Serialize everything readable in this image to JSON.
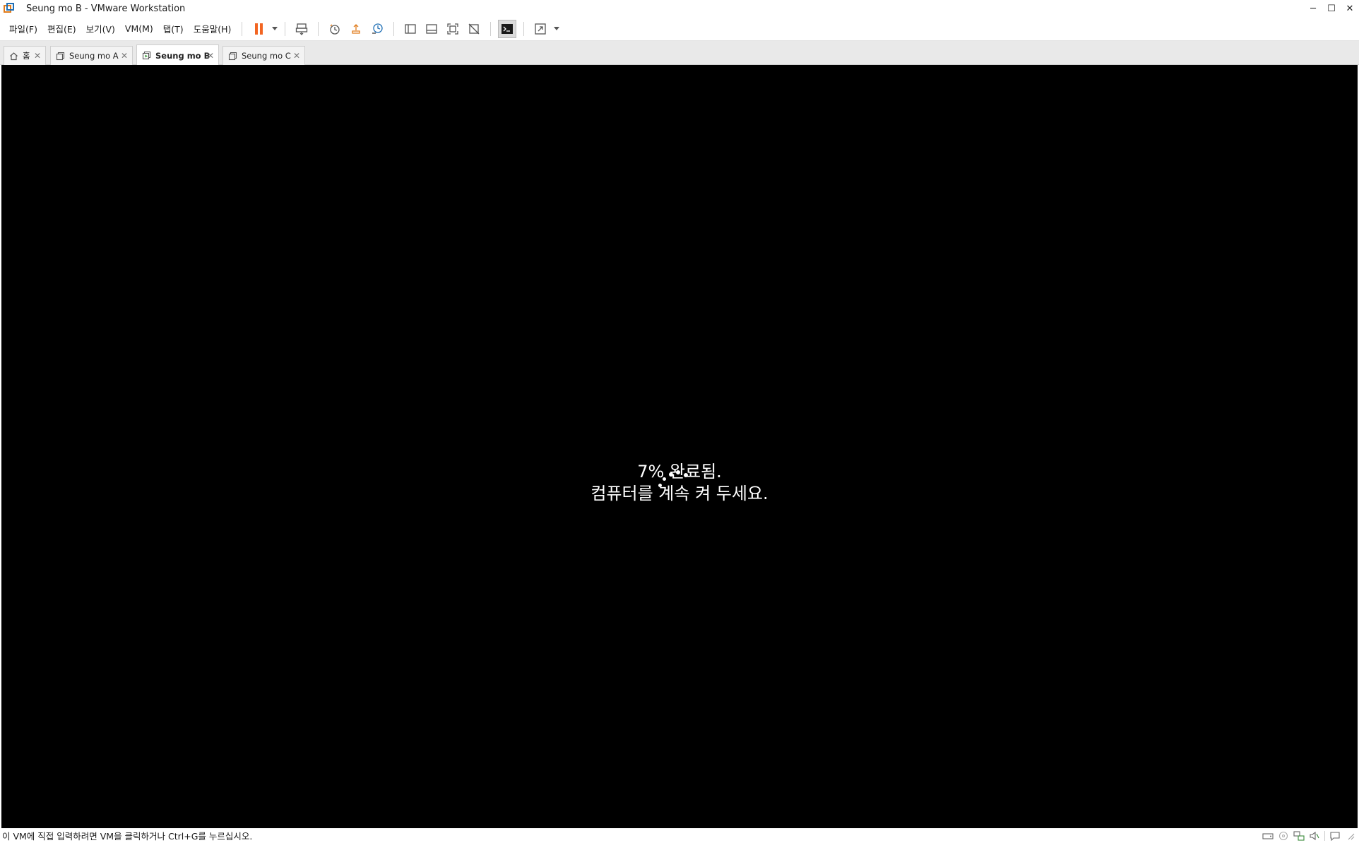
{
  "window": {
    "title": "Seung mo B - VMware Workstation",
    "controls": {
      "minimize": "─",
      "maximize": "☐",
      "close": "✕"
    }
  },
  "menu": {
    "items": [
      "파일(F)",
      "편집(E)",
      "보기(V)",
      "VM(M)",
      "탭(T)",
      "도움말(H)"
    ]
  },
  "toolbar": {
    "accent": "#f26522"
  },
  "tabs": [
    {
      "label": "홈",
      "icon": "home-icon",
      "selected": false
    },
    {
      "label": "Seung mo A",
      "icon": "vm-icon",
      "selected": false
    },
    {
      "label": "Seung mo B",
      "icon": "vm-running-icon",
      "selected": true
    },
    {
      "label": "Seung mo C",
      "icon": "vm-icon",
      "selected": false
    }
  ],
  "tab_close": "✕",
  "vm": {
    "progress_line": "7% 완료됨.",
    "message_line": "컴퓨터를 계속 켜 두세요."
  },
  "status": {
    "hint": "이 VM에 직접 입력하려면 VM을 클릭하거나 Ctrl+G를 누르십시오."
  }
}
